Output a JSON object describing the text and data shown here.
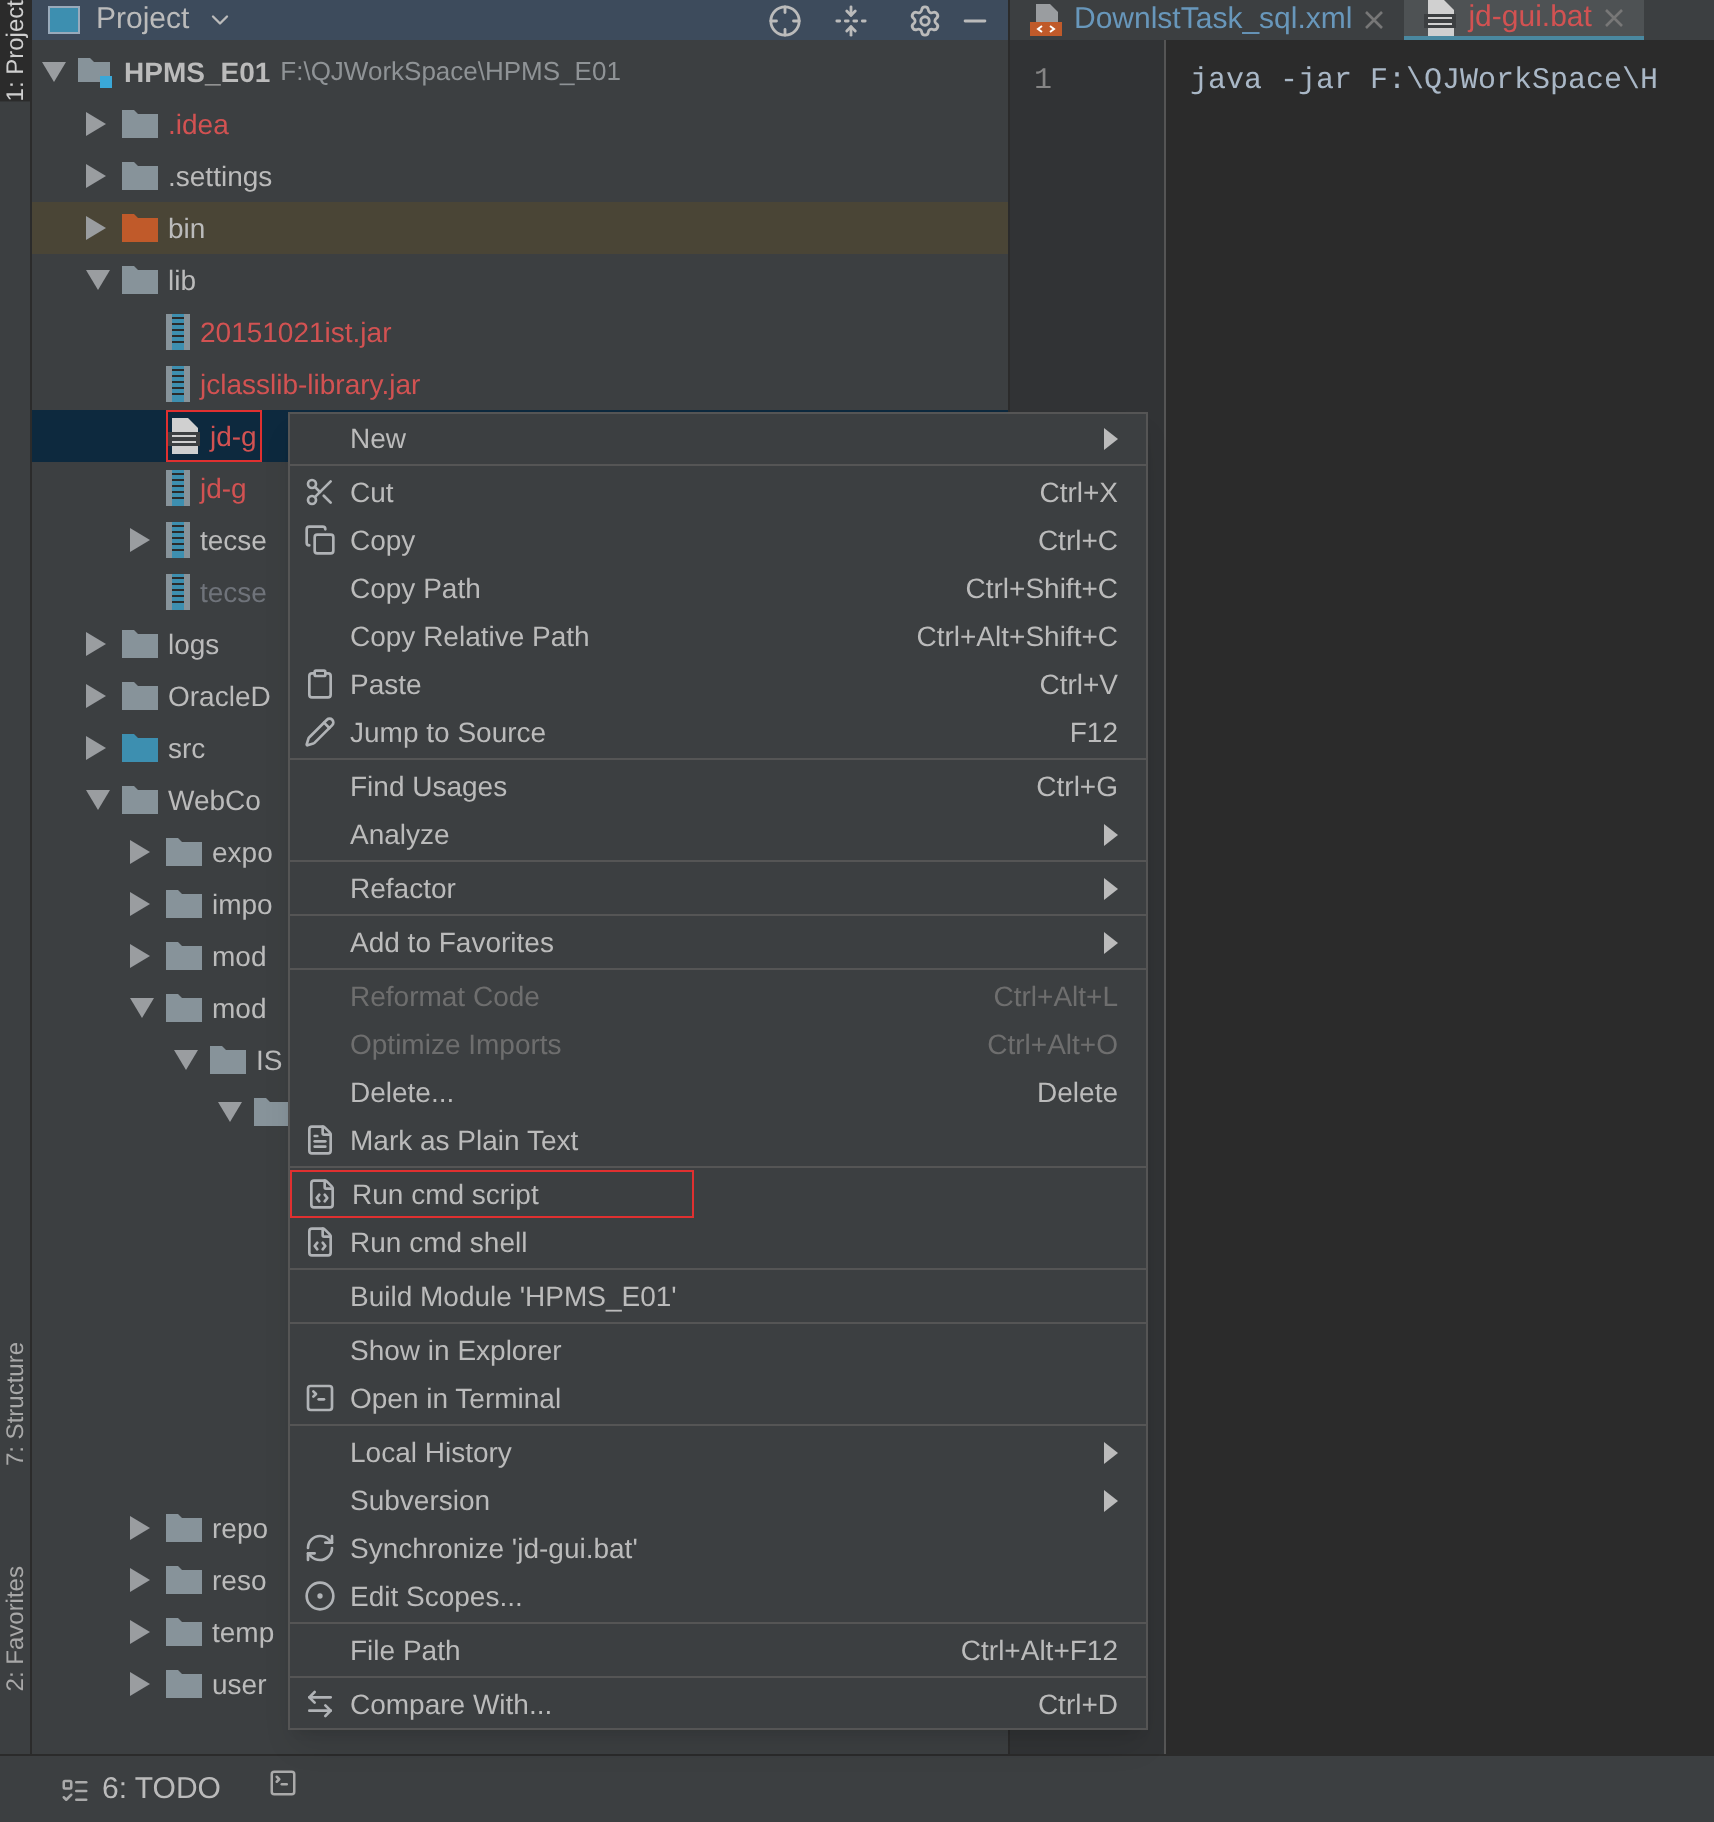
{
  "sidebar_tabs": [
    {
      "label": "1: Project",
      "selected": true
    },
    {
      "label": "7: Structure",
      "selected": false
    },
    {
      "label": "2: Favorites",
      "selected": false
    }
  ],
  "project_panel": {
    "title": "Project",
    "tree": [
      {
        "label": "HPMS_E01",
        "path": "F:\\QJWorkSpace\\HPMS_E01",
        "kind": "module",
        "color": "#bbbbbb",
        "selected": false,
        "expanded": true,
        "children": [
          {
            "label": ".idea",
            "kind": "folder",
            "color": "#d25252",
            "selected": false,
            "expanded": false
          },
          {
            "label": ".settings",
            "kind": "folder",
            "color": "#bbbbbb",
            "selected": false,
            "expanded": false
          },
          {
            "label": "bin",
            "kind": "excluded",
            "color": "#bbbbbb",
            "selected": false,
            "expanded": false
          },
          {
            "label": "lib",
            "kind": "folder",
            "color": "#bbbbbb",
            "selected": false,
            "expanded": true,
            "children": [
              {
                "label": "20151021ist.jar",
                "kind": "jar",
                "color": "#d25252",
                "selected": false
              },
              {
                "label": "jclasslib-library.jar",
                "kind": "jar",
                "color": "#d25252",
                "selected": false
              },
              {
                "label": "jd-g",
                "kind": "bat",
                "color": "#d25252",
                "selected": true,
                "framed": true
              },
              {
                "label": "jd-g",
                "kind": "jar",
                "color": "#d25252",
                "selected": false
              },
              {
                "label": "tecse",
                "kind": "jar",
                "color": "#bbbbbb",
                "selected": false,
                "expanded": false
              },
              {
                "label": "tecse",
                "kind": "jar",
                "color": "#6f737a",
                "selected": false
              }
            ]
          },
          {
            "label": "logs",
            "kind": "folder",
            "color": "#bbbbbb",
            "selected": false,
            "expanded": false
          },
          {
            "label": "OracleD",
            "kind": "folder",
            "color": "#bbbbbb",
            "selected": false,
            "expanded": false
          },
          {
            "label": "src",
            "kind": "source",
            "color": "#bbbbbb",
            "selected": false,
            "expanded": false
          },
          {
            "label": "WebCo",
            "kind": "folder",
            "color": "#bbbbbb",
            "selected": false,
            "expanded": true,
            "children": [
              {
                "label": "expo",
                "kind": "folder",
                "color": "#bbbbbb",
                "selected": false,
                "expanded": false
              },
              {
                "label": "impo",
                "kind": "folder",
                "color": "#bbbbbb",
                "selected": false,
                "expanded": false
              },
              {
                "label": "mod",
                "kind": "folder",
                "color": "#bbbbbb",
                "selected": false,
                "expanded": false
              },
              {
                "label": "mod",
                "kind": "folder",
                "color": "#bbbbbb",
                "selected": false,
                "expanded": true,
                "children": [
                  {
                    "label": "IS",
                    "kind": "folder",
                    "color": "#bbbbbb",
                    "selected": false,
                    "expanded": true,
                    "children": [
                      {
                        "kind": "folder",
                        "selected": false,
                        "expanded": true
                      }
                    ]
                  }
                ]
              },
              {
                "label": "repo",
                "kind": "folder",
                "color": "#bbbbbb",
                "selected": false,
                "expanded": false
              },
              {
                "label": "reso",
                "kind": "folder",
                "color": "#bbbbbb",
                "selected": false,
                "expanded": false
              },
              {
                "label": "temp",
                "kind": "folder",
                "color": "#bbbbbb",
                "selected": false,
                "expanded": false
              },
              {
                "label": "user",
                "kind": "folder",
                "color": "#bbbbbb",
                "selected": false,
                "expanded": false
              }
            ]
          }
        ]
      }
    ]
  },
  "editor": {
    "tabs": [
      {
        "label": "DownlstTask_sql.xml",
        "kind": "xml",
        "color": "#6897bb",
        "selected": false
      },
      {
        "label": "jd-gui.bat",
        "kind": "bat",
        "color": "#d25252",
        "selected": true
      }
    ],
    "lines": [
      {
        "number": "1",
        "code": "java -jar F:\\QJWorkSpace\\H"
      }
    ]
  },
  "context_menu": [
    [
      {
        "label": "New",
        "submenu": true
      }
    ],
    [
      {
        "label": "Cut",
        "kind": "scissors",
        "shortcut": "Ctrl+X"
      },
      {
        "label": "Copy",
        "kind": "copy",
        "shortcut": "Ctrl+C"
      },
      {
        "label": "Copy Path",
        "shortcut": "Ctrl+Shift+C"
      },
      {
        "label": "Copy Relative Path",
        "shortcut": "Ctrl+Alt+Shift+C"
      },
      {
        "label": "Paste",
        "kind": "clipboard",
        "shortcut": "Ctrl+V"
      },
      {
        "label": "Jump to Source",
        "kind": "pencil",
        "shortcut": "F12"
      }
    ],
    [
      {
        "label": "Find Usages",
        "shortcut": "Ctrl+G"
      },
      {
        "label": "Analyze",
        "submenu": true
      }
    ],
    [
      {
        "label": "Refactor",
        "submenu": true
      }
    ],
    [
      {
        "label": "Add to Favorites",
        "submenu": true
      }
    ],
    [
      {
        "label": "Reformat Code",
        "shortcut": "Ctrl+Alt+L",
        "disabled": true
      },
      {
        "label": "Optimize Imports",
        "shortcut": "Ctrl+Alt+O",
        "disabled": true
      },
      {
        "label": "Delete...",
        "shortcut": "Delete",
        "disabled": false
      },
      {
        "label": "Mark as Plain Text",
        "kind": "plaintext"
      }
    ],
    [
      {
        "label": "Run cmd script",
        "kind": "cmd",
        "framed": true
      },
      {
        "label": "Run cmd shell",
        "kind": "cmd",
        "framed": false
      }
    ],
    [
      {
        "label": "Build Module 'HPMS_E01'"
      }
    ],
    [
      {
        "label": "Show in Explorer"
      },
      {
        "label": "Open in Terminal",
        "kind": "terminal"
      }
    ],
    [
      {
        "label": "Local History",
        "submenu": true
      },
      {
        "label": "Subversion",
        "submenu": true
      },
      {
        "label": "Synchronize 'jd-gui.bat'",
        "kind": "sync"
      },
      {
        "label": "Edit Scopes...",
        "kind": "scope"
      }
    ],
    [
      {
        "label": "File Path",
        "shortcut": "Ctrl+Alt+F12"
      }
    ],
    [
      {
        "label": "Compare With...",
        "kind": "compare",
        "shortcut": "Ctrl+D"
      }
    ]
  ],
  "bottom_bar": {
    "tools": [
      {
        "label": "6: TODO"
      }
    ]
  }
}
